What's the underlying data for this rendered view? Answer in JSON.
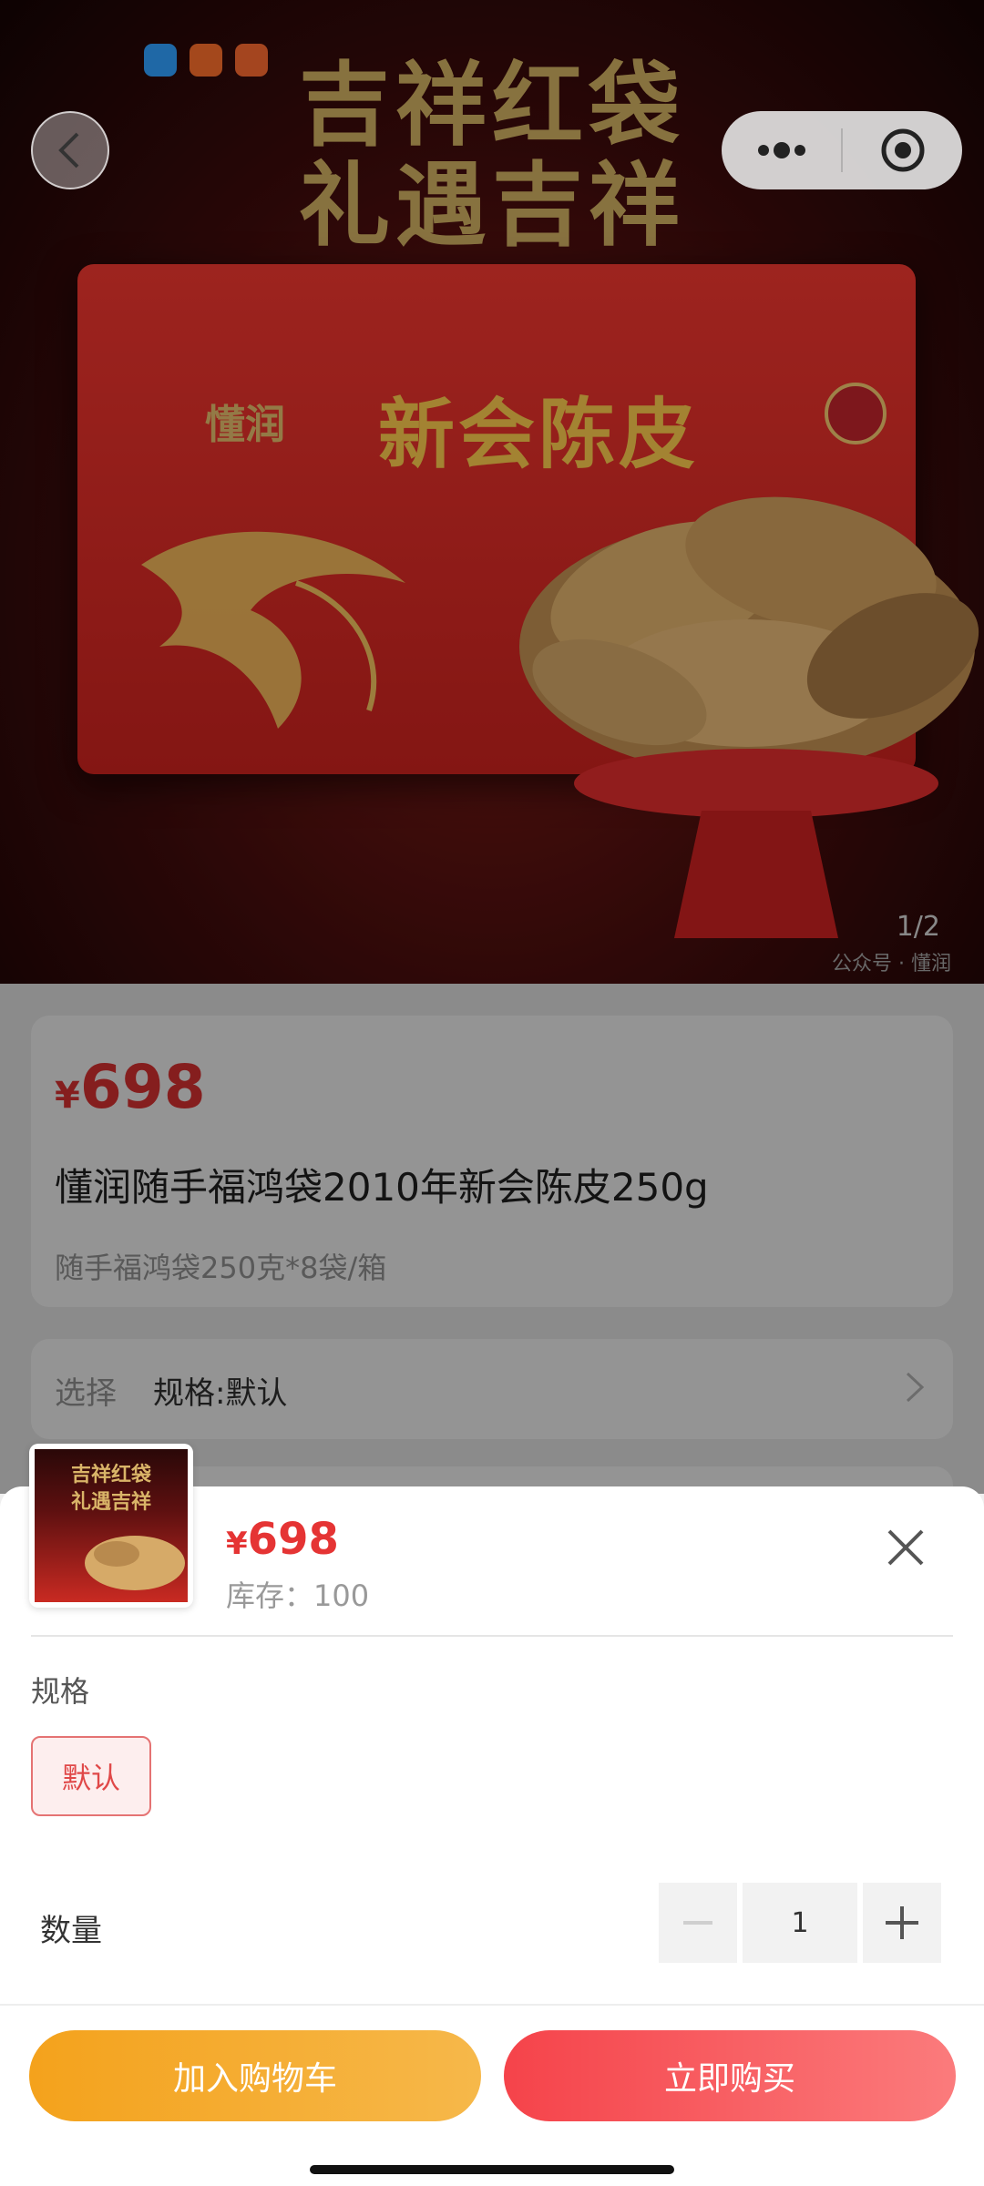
{
  "hero": {
    "title_line1": "吉祥红袋",
    "title_line2": "礼遇吉祥",
    "bag_brand": "懂润",
    "bag_name": "新会陈皮",
    "page_indicator": "1/2",
    "watermark": "公众号 · 懂润"
  },
  "top_bar": {
    "back_icon": "chevron-left-icon",
    "menu_icon": "more-dots-icon",
    "target_icon": "target-circle-icon"
  },
  "product": {
    "currency": "¥",
    "price": "698",
    "title": "懂润随手福鸿袋2010年新会陈皮250g",
    "subtitle": "随手福鸿袋250克*8袋/箱"
  },
  "spec_row": {
    "label": "选择",
    "value": "规格:默认"
  },
  "sheet": {
    "thumb_line1": "吉祥红袋",
    "thumb_line2": "礼遇吉祥",
    "currency": "¥",
    "price": "698",
    "stock": "库存：100",
    "spec_heading": "规格",
    "spec_option": "默认",
    "quantity_label": "数量",
    "quantity_value": "1",
    "add_to_cart": "加入购物车",
    "buy_now": "立即购买"
  },
  "colors": {
    "accent_red": "#e53434",
    "cart_orange": "#f4a21c",
    "buy_red": "#f5434a"
  }
}
